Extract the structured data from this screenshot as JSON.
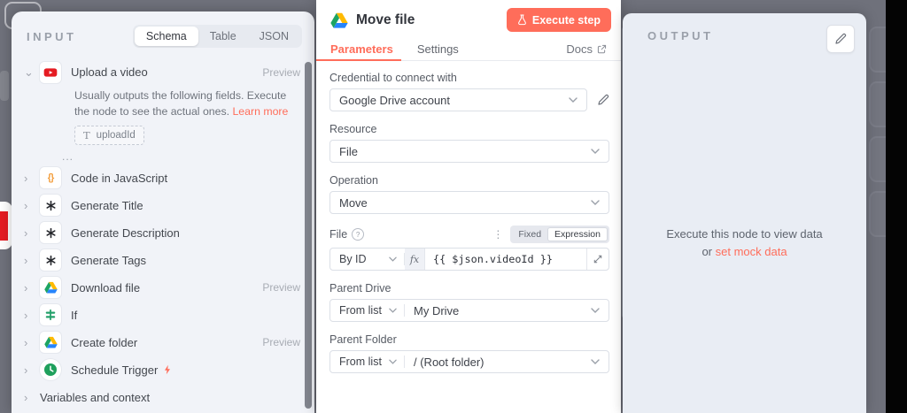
{
  "input_panel": {
    "title": "INPUT",
    "tabs": [
      {
        "label": "Schema",
        "active": true
      },
      {
        "label": "Table",
        "active": false
      },
      {
        "label": "JSON",
        "active": false
      }
    ],
    "note": {
      "text": "Usually outputs the following fields. Execute the node to see the actual ones.",
      "link": "Learn more"
    },
    "field_chip": {
      "icon": "text-type-icon",
      "t": "T",
      "label": "uploadId"
    },
    "ellipsis": "...",
    "items": [
      {
        "label": "Upload a video",
        "icon": "youtube-icon",
        "preview": "Preview",
        "expanded": true
      },
      {
        "label": "Code in JavaScript",
        "icon": "code-braces-icon"
      },
      {
        "label": "Generate Title",
        "icon": "openai-icon"
      },
      {
        "label": "Generate Description",
        "icon": "openai-icon"
      },
      {
        "label": "Generate Tags",
        "icon": "openai-icon"
      },
      {
        "label": "Download file",
        "icon": "google-drive-icon",
        "preview": "Preview"
      },
      {
        "label": "If",
        "icon": "if-icon"
      },
      {
        "label": "Create folder",
        "icon": "google-drive-icon",
        "preview": "Preview"
      },
      {
        "label": "Schedule Trigger",
        "icon": "schedule-trigger-icon",
        "has_bolt": true
      },
      {
        "label": "Variables and context"
      }
    ]
  },
  "dialog": {
    "icon": "google-drive-icon",
    "title": "Move file",
    "execute_button": {
      "icon": "flask-icon",
      "label": "Execute step"
    },
    "tabs": {
      "parameters": "Parameters",
      "settings": "Settings"
    },
    "docs": {
      "label": "Docs",
      "icon": "external-link-icon"
    },
    "credential": {
      "label": "Credential to connect with",
      "value": "Google Drive account"
    },
    "resource": {
      "label": "Resource",
      "value": "File"
    },
    "operation": {
      "label": "Operation",
      "value": "Move"
    },
    "file": {
      "label": "File",
      "mode": "By ID",
      "fx": "fx",
      "expression": "{{ $json.videoId }}",
      "toggle": {
        "fixed": "Fixed",
        "expression": "Expression",
        "active": "Expression"
      },
      "dots": "⋮"
    },
    "parent_drive": {
      "label": "Parent Drive",
      "mode": "From list",
      "value": "My Drive"
    },
    "parent_folder": {
      "label": "Parent Folder",
      "mode": "From list",
      "value": "/ (Root folder)"
    }
  },
  "output_panel": {
    "title": "OUTPUT",
    "empty_line1": "Execute this node to view data",
    "empty_or": "or",
    "empty_link": "set mock data"
  },
  "colors": {
    "accent": "#ff6d5a",
    "youtube_red": "#e51b22",
    "drive_green": "#1da462",
    "drive_yellow": "#ffba00",
    "drive_blue": "#2684fc",
    "schedule_green": "#1fa05c",
    "code_orange": "#f39e3d",
    "canvas": "#6f717b"
  }
}
